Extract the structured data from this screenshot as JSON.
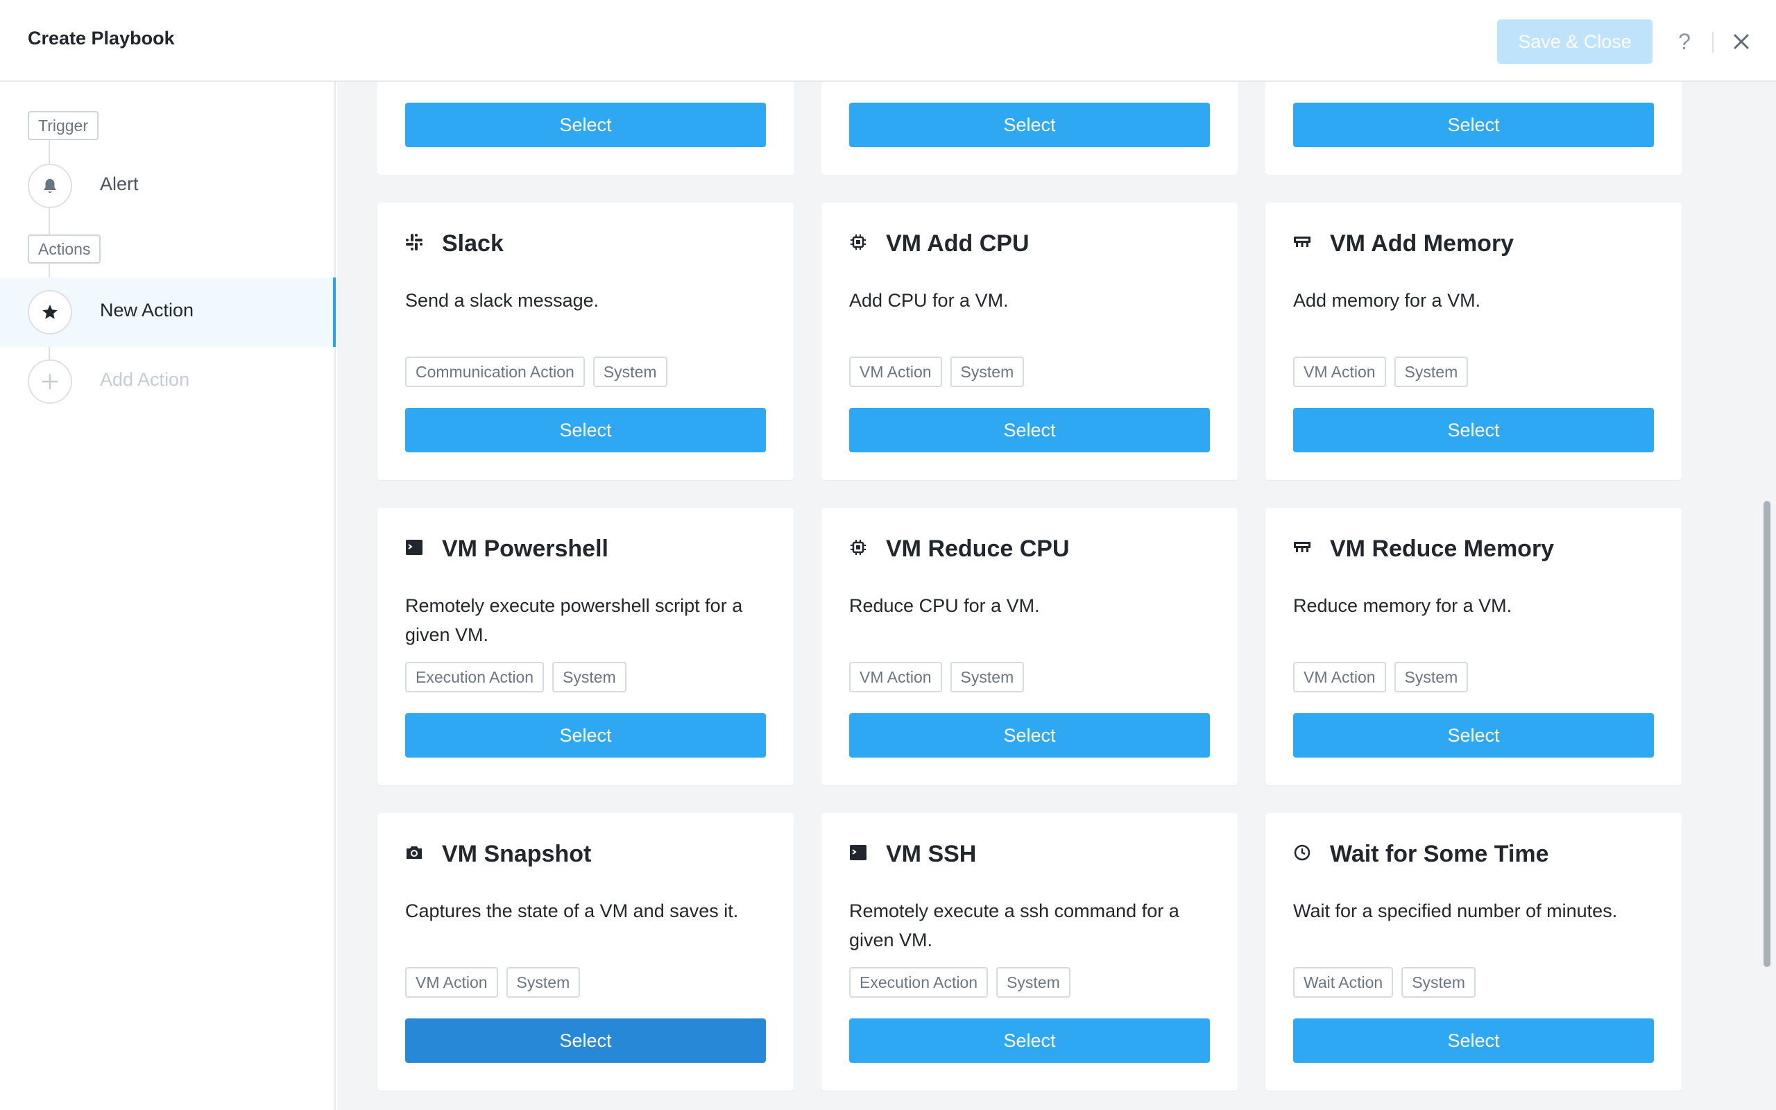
{
  "header": {
    "title": "Create Playbook",
    "save_label": "Save & Close",
    "help_label": "?"
  },
  "sidebar": {
    "trigger_label": "Trigger",
    "actions_label": "Actions",
    "steps": [
      {
        "label": "Alert",
        "icon": "bell-icon"
      },
      {
        "label": "New Action",
        "icon": "star-icon",
        "active": true
      },
      {
        "label": "Add Action",
        "icon": "plus-icon",
        "disabled": true
      }
    ]
  },
  "partial_cards": [
    {
      "select_label": "Select"
    },
    {
      "select_label": "Select"
    },
    {
      "select_label": "Select"
    }
  ],
  "cards": [
    {
      "title": "Slack",
      "icon": "slack-icon",
      "description": "Send a slack message.",
      "tags": [
        "Communication Action",
        "System"
      ],
      "select_label": "Select"
    },
    {
      "title": "VM Add CPU",
      "icon": "cpu-icon",
      "description": "Add CPU for a VM.",
      "tags": [
        "VM Action",
        "System"
      ],
      "select_label": "Select"
    },
    {
      "title": "VM Add Memory",
      "icon": "memory-icon",
      "description": "Add memory for a VM.",
      "tags": [
        "VM Action",
        "System"
      ],
      "select_label": "Select"
    },
    {
      "title": "VM Powershell",
      "icon": "terminal-icon",
      "description": "Remotely execute powershell script for a given VM.",
      "tags": [
        "Execution Action",
        "System"
      ],
      "select_label": "Select"
    },
    {
      "title": "VM Reduce CPU",
      "icon": "cpu-icon",
      "description": "Reduce CPU for a VM.",
      "tags": [
        "VM Action",
        "System"
      ],
      "select_label": "Select"
    },
    {
      "title": "VM Reduce Memory",
      "icon": "memory-icon",
      "description": "Reduce memory for a VM.",
      "tags": [
        "VM Action",
        "System"
      ],
      "select_label": "Select"
    },
    {
      "title": "VM Snapshot",
      "icon": "camera-icon",
      "description": "Captures the state of a VM and saves it.",
      "tags": [
        "VM Action",
        "System"
      ],
      "select_label": "Select"
    },
    {
      "title": "VM SSH",
      "icon": "terminal-icon",
      "description": "Remotely execute a ssh command for a given VM.",
      "tags": [
        "Execution Action",
        "System"
      ],
      "select_label": "Select"
    },
    {
      "title": "Wait for Some Time",
      "icon": "clock-icon",
      "description": "Wait for a specified number of minutes.",
      "tags": [
        "Wait Action",
        "System"
      ],
      "select_label": "Select"
    }
  ],
  "colors": {
    "accent": "#2ea8f2",
    "accent_pressed": "#2788d8",
    "save_disabled": "#bfe3fb",
    "background": "#f2f4f6"
  }
}
